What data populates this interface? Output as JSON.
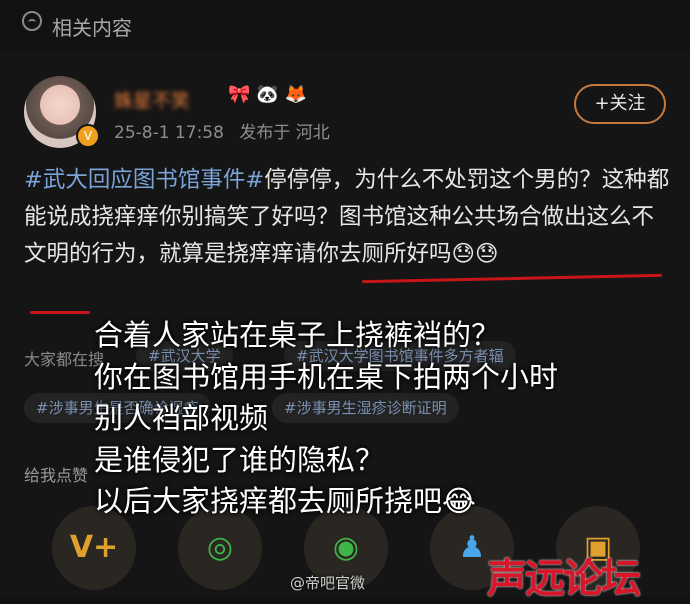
{
  "header": {
    "title": "相关内容"
  },
  "user": {
    "name": "姝星不笑",
    "badges": "🎀🐼🦊",
    "date": "25-8-1 17:58",
    "location": "发布于 河北",
    "verified_mark": "V"
  },
  "follow_button": {
    "label": "+关注"
  },
  "post": {
    "hashtag": "#武大回应图书馆事件#",
    "text_part1": "停停停，为什么不处罚这个男的？这种都能说成挠痒痒你别搞笑了好吗？图书馆这种公共场合做出这么不文明的行为，",
    "text_part2": "就算是挠痒痒请你去厕所好吗",
    "emoji": "😓😓"
  },
  "search": {
    "label": "大家都在搜",
    "chips": [
      "#武汉大学",
      "#武汉大学图书馆事件多方者辐",
      "#涉事男生是否确诊湿疹",
      "#涉事男生湿疹诊断证明"
    ]
  },
  "give_label": "给我点赞",
  "bottom_buttons": [
    {
      "icon": "vip-icon",
      "glyph": "V+"
    },
    {
      "icon": "wechat-icon",
      "glyph": "◎"
    },
    {
      "icon": "moments-icon",
      "glyph": "◉"
    },
    {
      "icon": "qq-icon",
      "glyph": "♟"
    },
    {
      "icon": "picture-icon",
      "glyph": "▣"
    }
  ],
  "overlay_lines": [
    "合着人家站在桌子上挠裤裆的？",
    "你在图书馆用手机在桌下拍两个小时",
    "别人裆部视频",
    "是谁侵犯了谁的隐私？",
    "以后大家挠痒都去厕所挠吧😂"
  ],
  "watermark": "@帝吧官微",
  "logo_text": "声远论坛",
  "colors": {
    "accent": "#e07a3a",
    "link": "#7aa3d8",
    "underline": "#c8151a"
  }
}
